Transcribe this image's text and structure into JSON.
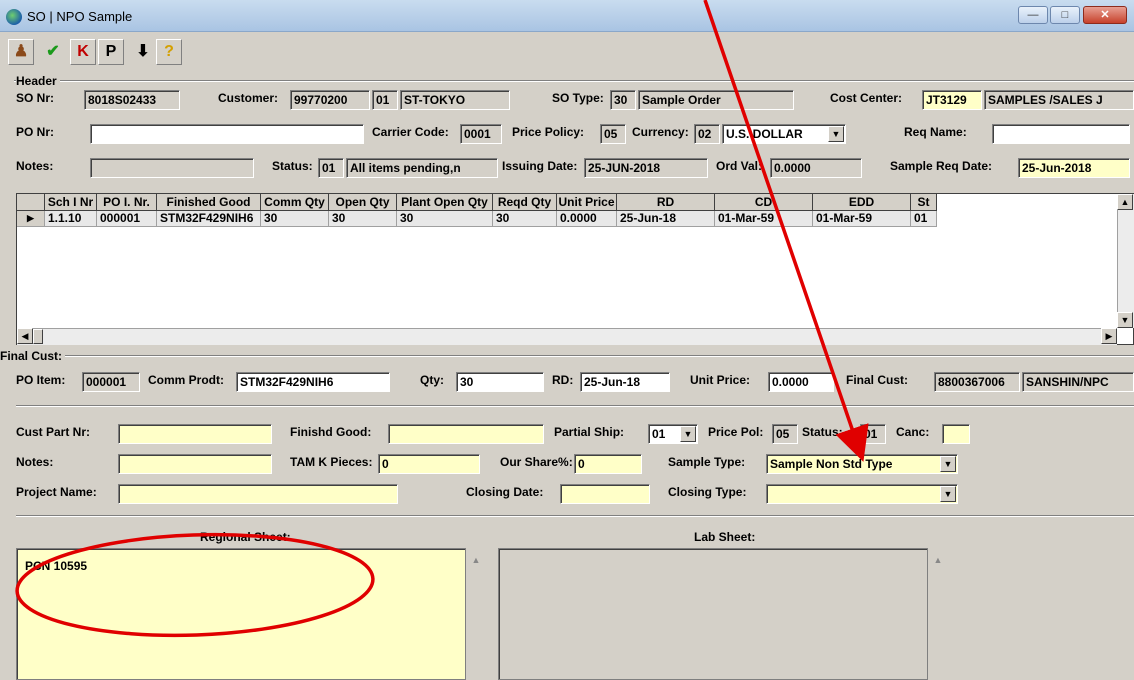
{
  "window": {
    "title": "SO | NPO Sample"
  },
  "toolbar": {
    "k_label": "K",
    "p_label": "P"
  },
  "header": {
    "group_label": "Header",
    "so_nr_label": "SO Nr:",
    "so_nr": "8018S02433",
    "customer_label": "Customer:",
    "customer_code": "99770200",
    "customer_sub": "01",
    "customer_name": "ST-TOKYO",
    "so_type_label": "SO Type:",
    "so_type_code": "30",
    "so_type_name": "Sample Order",
    "cost_center_label": "Cost Center:",
    "cost_center_code": "JT3129",
    "cost_center_name": "SAMPLES /SALES J",
    "po_nr_label": "PO Nr:",
    "po_nr": "",
    "carrier_code_label": "Carrier Code:",
    "carrier_code": "0001",
    "price_policy_label": "Price Policy:",
    "price_policy": "05",
    "currency_label": "Currency:",
    "currency_code": "02",
    "currency_name": "U.S. DOLLAR",
    "req_name_label": "Req Name:",
    "req_name": "",
    "notes_label": "Notes:",
    "notes": "",
    "status_label": "Status:",
    "status_code": "01",
    "status_text": "All items pending,n",
    "issuing_date_label": "Issuing Date:",
    "issuing_date": "25-JUN-2018",
    "ord_val_label": "Ord Val:",
    "ord_val": "0.0000",
    "sample_req_date_label": "Sample Req Date:",
    "sample_req_date": "25-Jun-2018"
  },
  "grid": {
    "columns": [
      "Sch I Nr",
      "PO I. Nr.",
      "Finished Good",
      "Comm Qty",
      "Open Qty",
      "Plant Open Qty",
      "Reqd Qty",
      "Unit Price",
      "RD",
      "CD",
      "EDD",
      "St"
    ],
    "rows": [
      [
        "1.1.10",
        "000001",
        "STM32F429NIH6",
        "30",
        "30",
        "30",
        "30",
        "0.0000",
        "25-Jun-18",
        "01-Mar-59",
        "01-Mar-59",
        "01"
      ]
    ]
  },
  "final_cust": {
    "group_label": "Final Cust:",
    "po_item_label": "PO Item:",
    "po_item": "000001",
    "comm_prodt_label": "Comm Prodt:",
    "comm_prodt": "STM32F429NIH6",
    "qty_label": "Qty:",
    "qty": "30",
    "rd_label": "RD:",
    "rd": "25-Jun-18",
    "unit_price_label": "Unit Price:",
    "unit_price": "0.0000",
    "final_cust_label": "Final Cust:",
    "final_cust_code": "8800367006",
    "final_cust_name": "SANSHIN/NPC"
  },
  "details": {
    "cust_part_nr_label": "Cust Part Nr:",
    "cust_part_nr": "",
    "finishd_good_label": "Finishd Good:",
    "finishd_good": "",
    "partial_ship_label": "Partial Ship:",
    "partial_ship": "01",
    "price_pol_label": "Price Pol:",
    "price_pol": "05",
    "status_label": "Status:",
    "status": "01",
    "canc_label": "Canc:",
    "canc": "",
    "notes_label": "Notes:",
    "notes": "",
    "tam_k_pieces_label": "TAM K Pieces:",
    "tam_k_pieces": "0",
    "our_share_label": "Our Share%:",
    "our_share": "0",
    "sample_type_label": "Sample Type:",
    "sample_type": "Sample Non Std Type",
    "project_name_label": "Project Name:",
    "project_name": "",
    "closing_date_label": "Closing Date:",
    "closing_date": "",
    "closing_type_label": "Closing Type:",
    "closing_type": ""
  },
  "sheets": {
    "regional_label": "Regional Sheet:",
    "regional_text": "PCN 10595",
    "lab_label": "Lab Sheet:",
    "lab_text": ""
  },
  "colors": {
    "annotation": "#e00000",
    "field_yellow": "#ffffc8",
    "window_gray": "#d4d0c8"
  }
}
